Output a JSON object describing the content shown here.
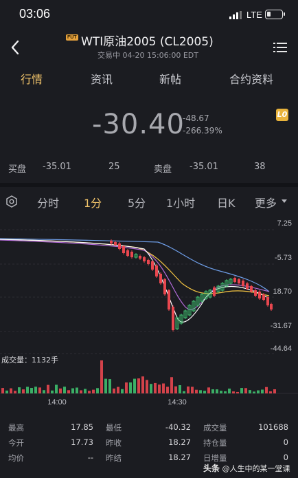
{
  "status": {
    "time": "03:06",
    "network": "LTE",
    "battery_icon": "battery-icon"
  },
  "header": {
    "badge": "FUT",
    "title": "WTI原油2005 (CL2005)",
    "subtitle": "交易中 04-20 15:06:00 EDT"
  },
  "top_tabs": [
    "行情",
    "资讯",
    "新帖",
    "合约资料"
  ],
  "top_tabs_active": 0,
  "quote": {
    "price": "-30.40",
    "change": "-48.67",
    "change_pct": "-266.39%",
    "level_badge": "L0"
  },
  "order_book": {
    "bid_label": "买盘",
    "bid_price": "-35.01",
    "bid_size": "25",
    "ask_label": "卖盘",
    "ask_price": "-35.01",
    "ask_size": "38"
  },
  "period_tabs": [
    "分时",
    "1分",
    "5分",
    "1小时",
    "日K",
    "更多"
  ],
  "period_tabs_active": 1,
  "volume_label": "成交量：1132手",
  "chart_data": {
    "type": "candlestick",
    "y_ticks": [
      "7.25",
      "-5.73",
      "18.70",
      "-31.67",
      "-44.64"
    ],
    "x_ticks": [
      "14:00",
      "14:30"
    ],
    "ylim": [
      -44.64,
      7.25
    ],
    "colors": {
      "up": "#3fbf6e",
      "down": "#e8474f",
      "ma1": "#ffffff",
      "ma2": "#f5c542",
      "ma3": "#b36bd8",
      "ma4": "#6e9ee8"
    }
  },
  "stats": [
    [
      {
        "k": "最高",
        "v": "17.85"
      },
      {
        "k": "最低",
        "v": "-40.32"
      },
      {
        "k": "成交量",
        "v": "101688"
      }
    ],
    [
      {
        "k": "今开",
        "v": "17.73"
      },
      {
        "k": "昨收",
        "v": "18.27"
      },
      {
        "k": "持仓量",
        "v": "0"
      }
    ],
    [
      {
        "k": "均价",
        "v": "--"
      },
      {
        "k": "昨结",
        "v": "18.27"
      },
      {
        "k": "日增量",
        "v": "0"
      }
    ]
  ],
  "watermark": {
    "brand": "头条",
    "handle": "@人生中的某一堂课"
  }
}
